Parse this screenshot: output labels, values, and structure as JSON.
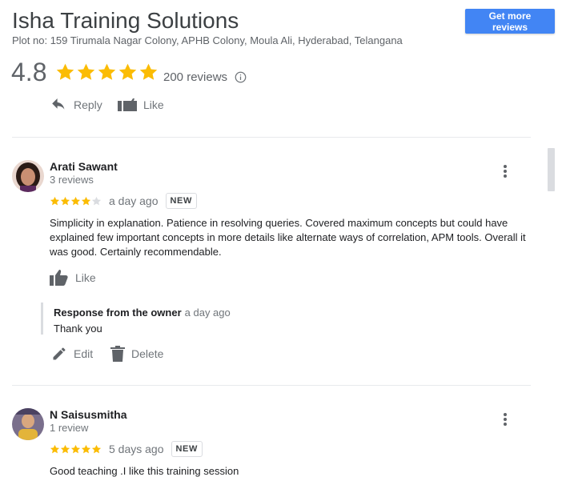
{
  "header": {
    "business_name": "Isha Training Solutions",
    "address": "Plot no: 159 Tirumala Nagar Colony, APHB Colony, Moula Ali, Hyderabad, Telangana",
    "get_reviews_label": "Get more reviews",
    "rating": "4.8",
    "rating_stars": 5,
    "reviews_count": "200 reviews",
    "reply_label": "Reply",
    "like_label": "Like"
  },
  "colors": {
    "star": "#fbbc04",
    "star_empty": "#dadce0",
    "accent": "#4285f4"
  },
  "reviews": [
    {
      "name": "Arati Sawant",
      "review_count": "3 reviews",
      "stars": 4,
      "time": "a day ago",
      "badge": "NEW",
      "text": "Simplicity in explanation. Patience in resolving queries. Covered maximum concepts but could have explained few important concepts in more details like alternate ways of correlation, APM tools. Overall it was good. Certainly recommendable.",
      "like_label": "Like",
      "owner_response": {
        "label": "Response from the owner",
        "time": "a day ago",
        "text": "Thank you"
      },
      "edit_label": "Edit",
      "delete_label": "Delete"
    },
    {
      "name": "N Saisusmitha",
      "review_count": "1 review",
      "stars": 5,
      "time": "5 days ago",
      "badge": "NEW",
      "text": "Good teaching .I like this training session"
    }
  ]
}
